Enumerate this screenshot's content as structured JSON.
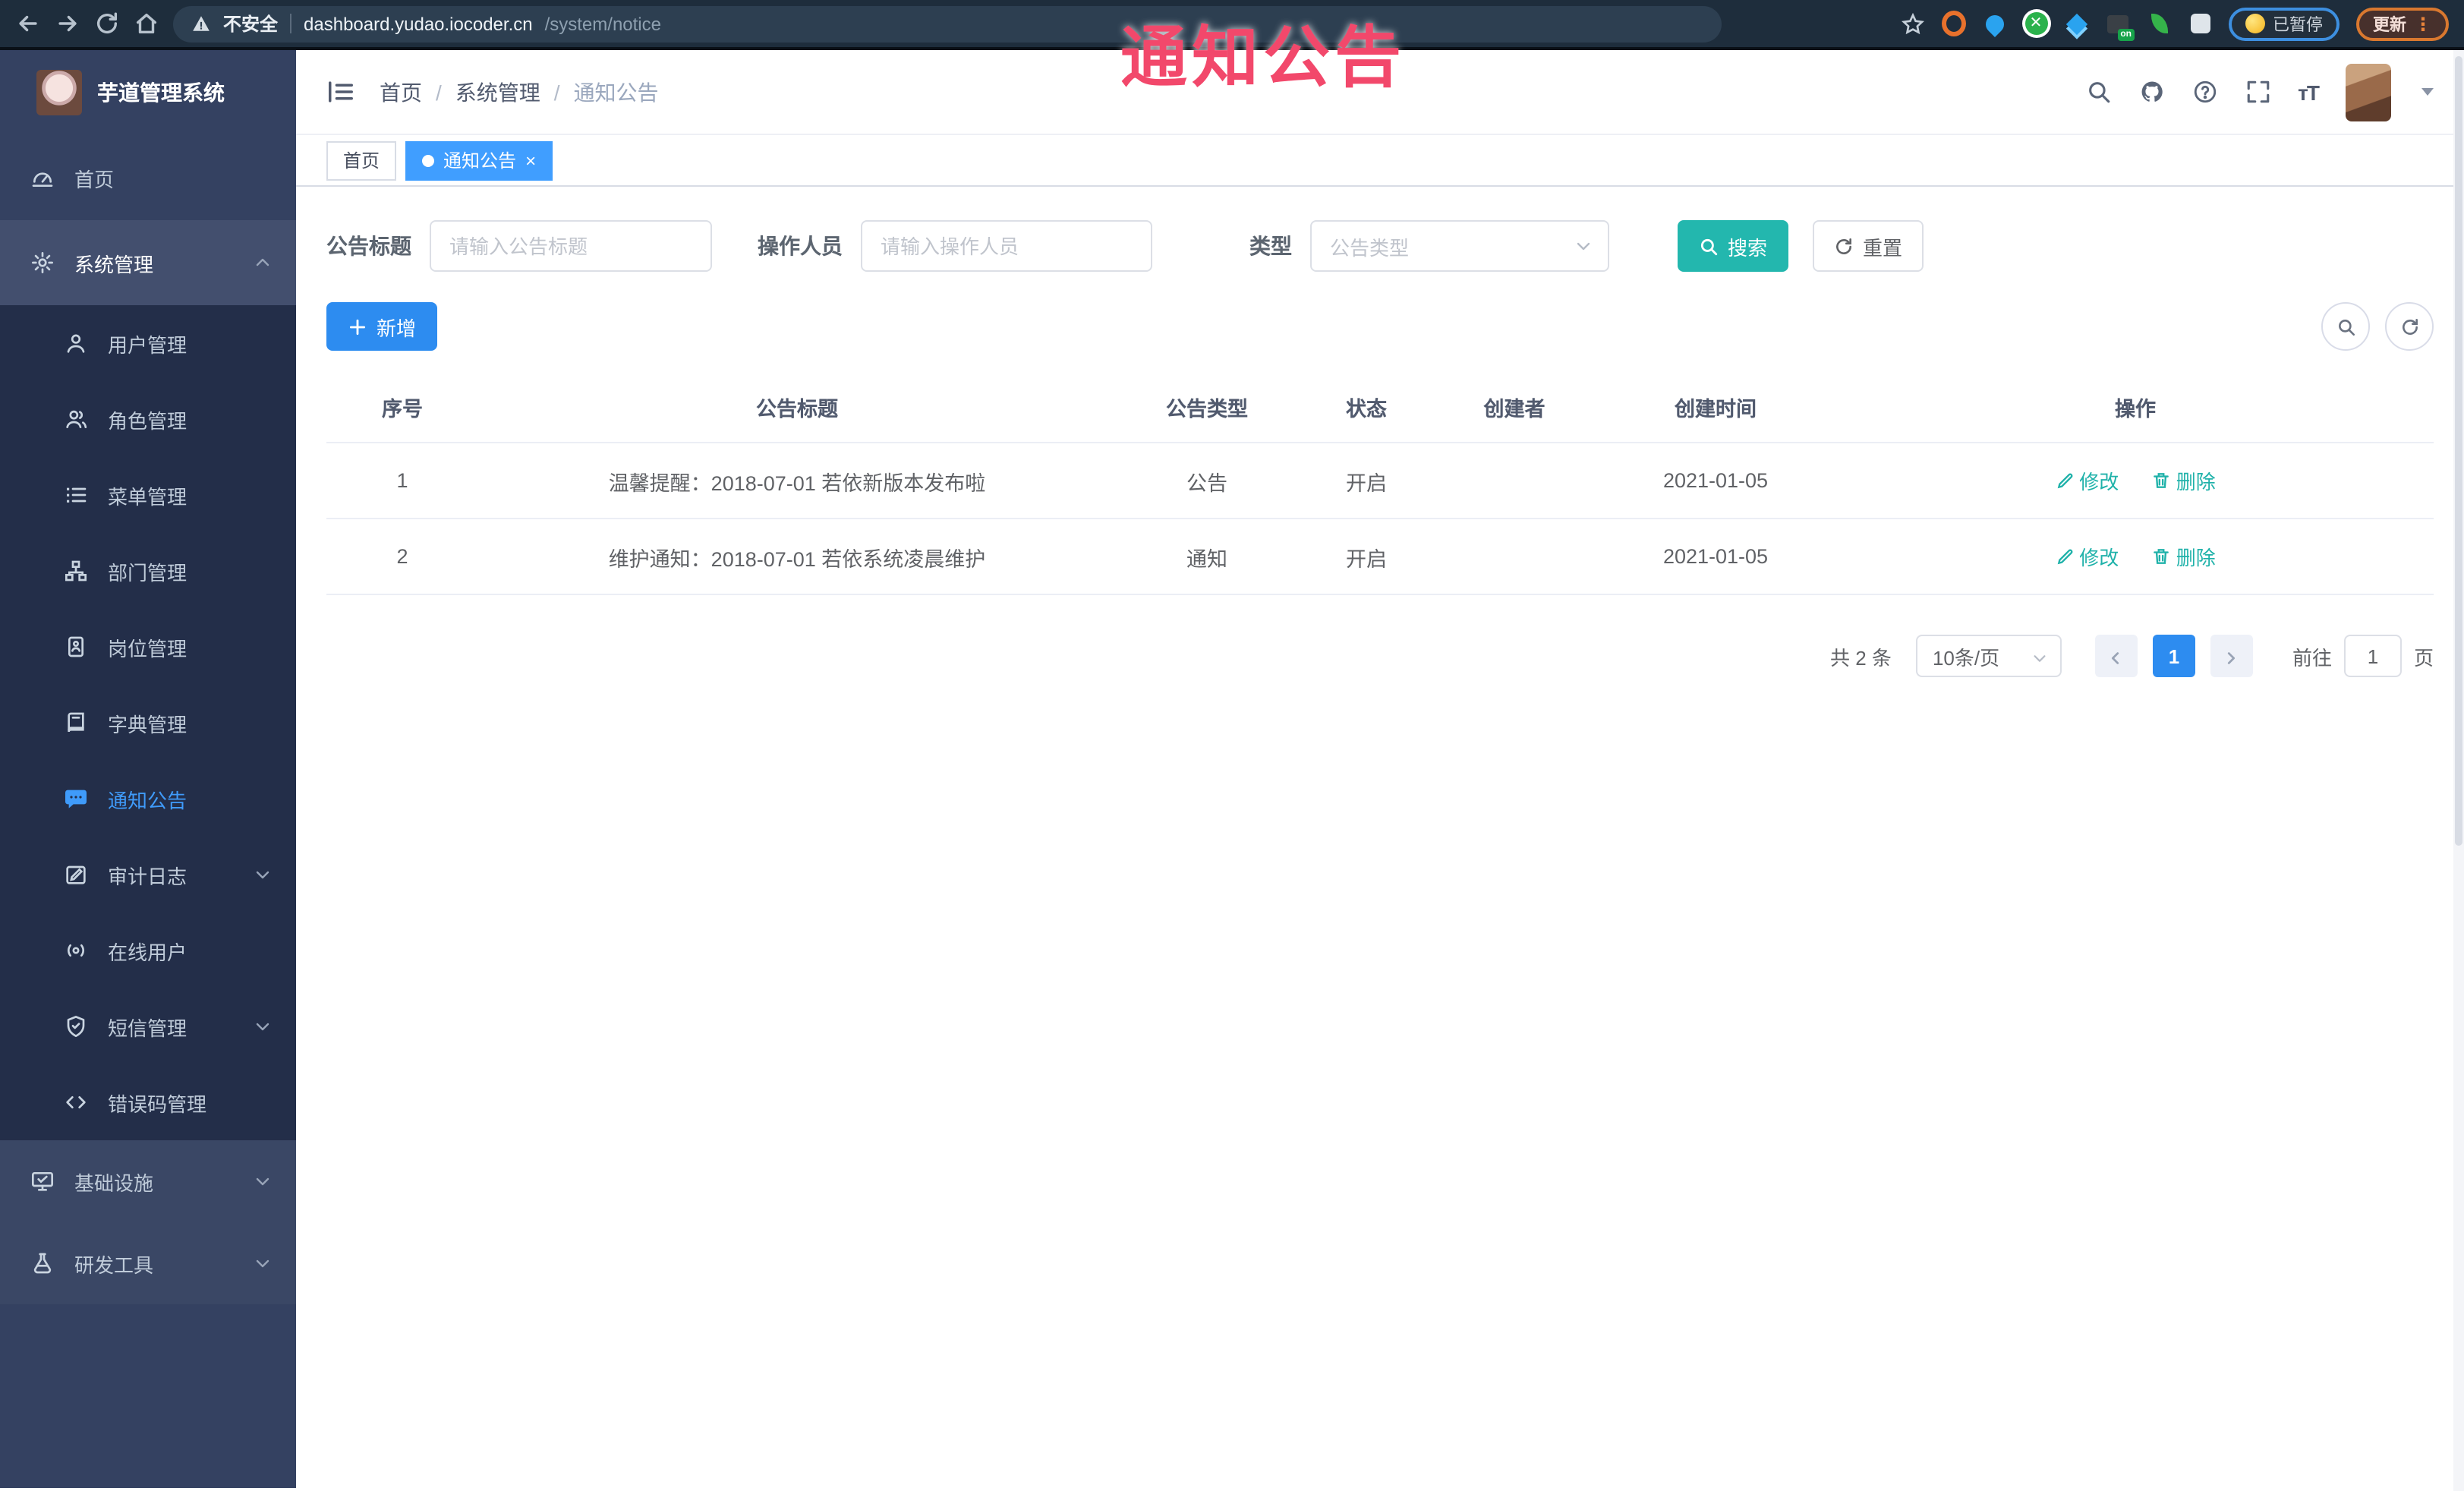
{
  "browser": {
    "security_label": "不安全",
    "url_host": "dashboard.yudao.iocoder.cn",
    "url_path": "/system/notice",
    "extension_badge": "on",
    "paused_label": "已暂停",
    "update_label": "更新"
  },
  "annotation": {
    "text": "通知公告",
    "color": "#f2486b"
  },
  "sidebar": {
    "logo_title": "芋道管理系统",
    "items": [
      {
        "label": "首页"
      },
      {
        "label": "系统管理"
      },
      {
        "label": "用户管理"
      },
      {
        "label": "角色管理"
      },
      {
        "label": "菜单管理"
      },
      {
        "label": "部门管理"
      },
      {
        "label": "岗位管理"
      },
      {
        "label": "字典管理"
      },
      {
        "label": "通知公告"
      },
      {
        "label": "审计日志"
      },
      {
        "label": "在线用户"
      },
      {
        "label": "短信管理"
      },
      {
        "label": "错误码管理"
      },
      {
        "label": "基础设施"
      },
      {
        "label": "研发工具"
      }
    ]
  },
  "navbar": {
    "breadcrumb": [
      "首页",
      "系统管理",
      "通知公告"
    ]
  },
  "tags": {
    "home": "首页",
    "active": "通知公告",
    "close": "×"
  },
  "filters": {
    "title_label": "公告标题",
    "title_placeholder": "请输入公告标题",
    "operator_label": "操作人员",
    "operator_placeholder": "请输入操作人员",
    "type_label": "类型",
    "type_placeholder": "公告类型",
    "search_label": "搜索",
    "reset_label": "重置"
  },
  "toolbar": {
    "add_label": "新增"
  },
  "table": {
    "columns": [
      "序号",
      "公告标题",
      "公告类型",
      "状态",
      "创建者",
      "创建时间",
      "操作"
    ],
    "rows": [
      {
        "no": "1",
        "title": "温馨提醒：2018-07-01 若依新版本发布啦",
        "type": "公告",
        "status": "开启",
        "creator": "",
        "created": "2021-01-05",
        "edit": "修改",
        "delete": "删除"
      },
      {
        "no": "2",
        "title": "维护通知：2018-07-01 若依系统凌晨维护",
        "type": "通知",
        "status": "开启",
        "creator": "",
        "created": "2021-01-05",
        "edit": "修改",
        "delete": "删除"
      }
    ]
  },
  "pagination": {
    "total": "共 2 条",
    "page_size": "10条/页",
    "current": "1",
    "goto_label": "前往",
    "goto_value": "1",
    "page_unit": "页"
  },
  "colors": {
    "primary": "#2d8cf0",
    "teal": "#23b7ae",
    "tag_active": "#409eff",
    "annotation": "#f2486b"
  }
}
